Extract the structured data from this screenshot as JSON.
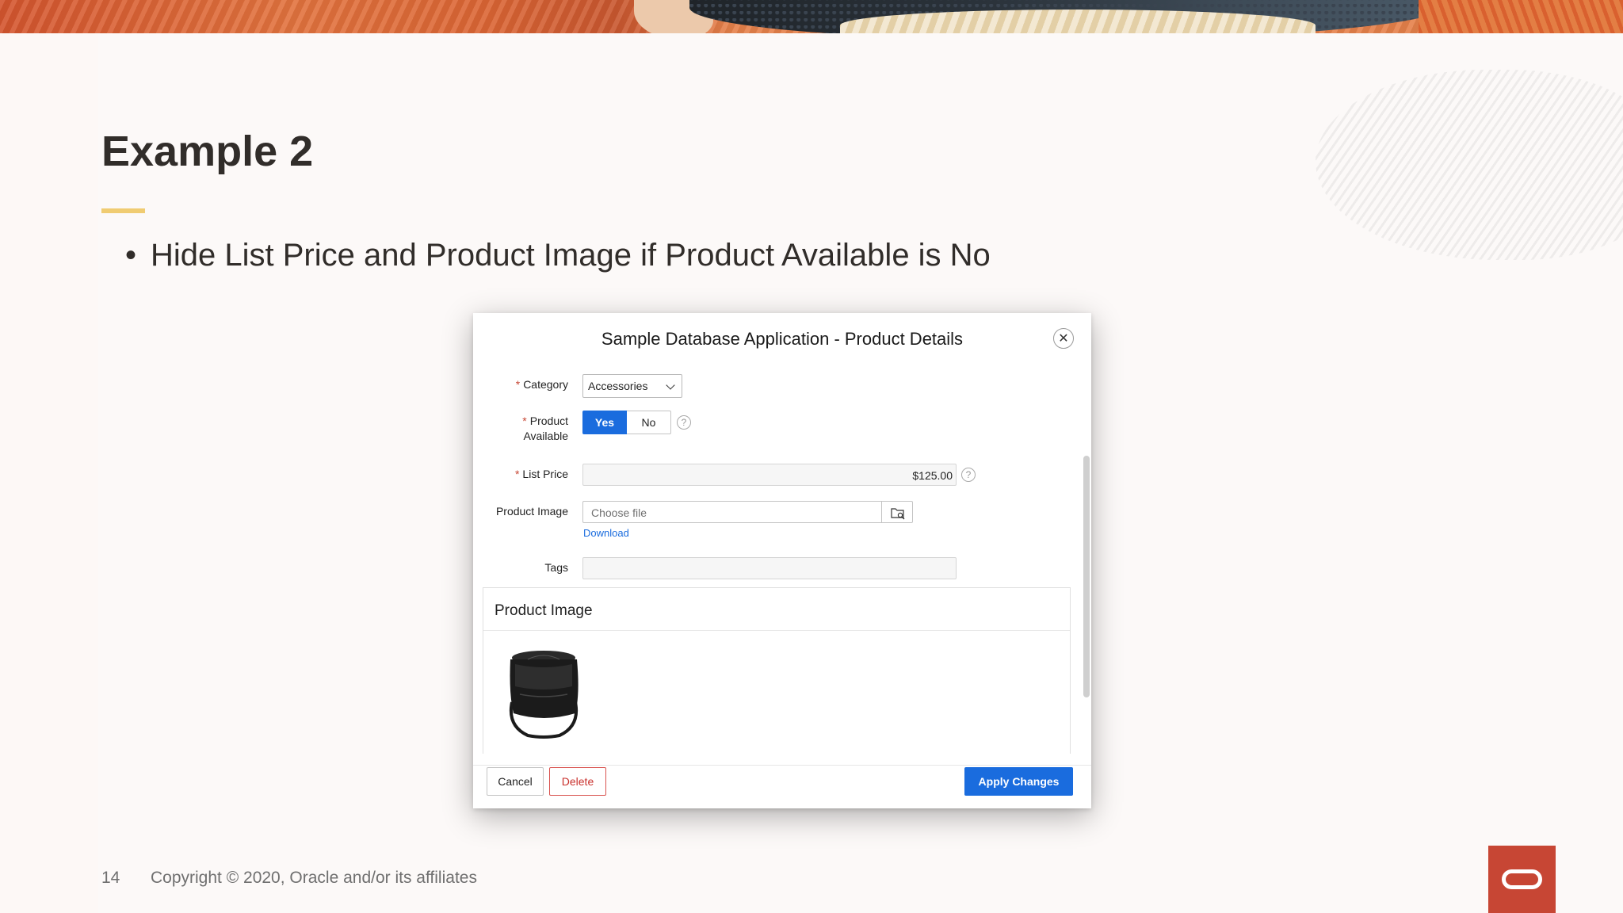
{
  "slide": {
    "title": "Example 2",
    "bullet": "Hide List Price and Product Image if Product Available is No",
    "page_number": "14",
    "copyright": "Copyright © 2020, Oracle and/or its affiliates"
  },
  "dialog": {
    "title": "Sample Database Application - Product Details",
    "close_symbol": "✕",
    "fields": {
      "category_label": "Category",
      "category_value": "Accessories",
      "product_available_label_line1": "Product",
      "product_available_label_line2": "Available",
      "yes_label": "Yes",
      "no_label": "No",
      "selected": "Yes",
      "list_price_label": "List Price",
      "list_price_value": "$125.00",
      "product_image_label": "Product Image",
      "file_placeholder": "Choose file",
      "download_link": "Download",
      "tags_label": "Tags",
      "tags_value": "",
      "required_marker": "*",
      "help_symbol": "?"
    },
    "region": {
      "title": "Product Image"
    },
    "buttons": {
      "cancel": "Cancel",
      "delete": "Delete",
      "apply": "Apply Changes"
    }
  },
  "colors": {
    "primary_blue": "#1a6cde",
    "danger_red": "#c9302c",
    "oracle_red": "#c74634",
    "title_accent": "#f0cc72"
  },
  "icons": [
    "close-icon",
    "chevron-down-icon",
    "help-icon",
    "folder-search-icon",
    "oracle-logo"
  ]
}
